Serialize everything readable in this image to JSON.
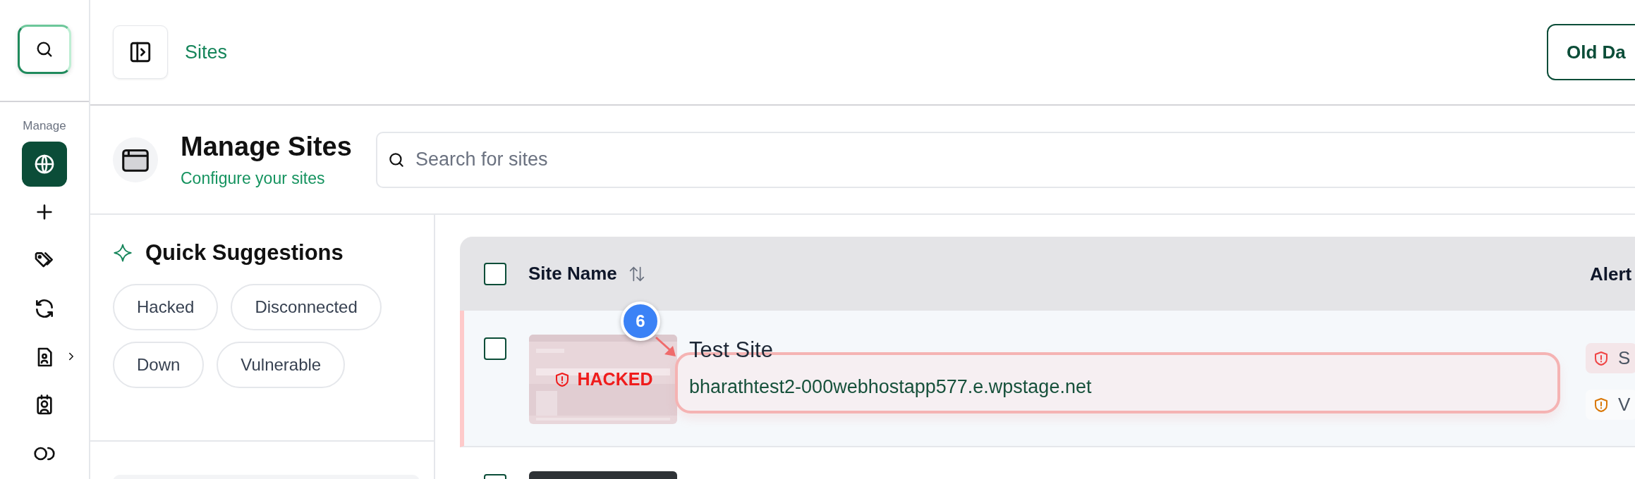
{
  "rail": {
    "section_label": "Manage",
    "items": [
      {
        "kind": "globe",
        "selected": true,
        "has_submenu": false
      },
      {
        "kind": "plus",
        "selected": false,
        "has_submenu": false
      },
      {
        "kind": "tags",
        "selected": false,
        "has_submenu": false
      },
      {
        "kind": "refresh",
        "selected": false,
        "has_submenu": false
      },
      {
        "kind": "report",
        "selected": false,
        "has_submenu": true
      },
      {
        "kind": "contact",
        "selected": false,
        "has_submenu": false
      },
      {
        "kind": "users",
        "selected": false,
        "has_submenu": false
      }
    ]
  },
  "topbar": {
    "breadcrumb": "Sites",
    "button": "Old Da"
  },
  "header": {
    "title": "Manage Sites",
    "subtitle": "Configure your sites",
    "search": {
      "placeholder": "Search for sites"
    }
  },
  "suggestions": {
    "title": "Quick Suggestions",
    "chips": [
      "Hacked",
      "Disconnected",
      "Down",
      "Vulnerable"
    ]
  },
  "table": {
    "columns": [
      "Site Name",
      "Alert"
    ],
    "select_all_checked": false,
    "rows": [
      {
        "checked": false,
        "highlighted": true,
        "status": "HACKED",
        "title": "Test Site",
        "url": "bharathtest2-000webhostapp577.e.wpstage.net",
        "annotation": "6",
        "alerts": [
          {
            "label": "S",
            "color": "#ef4444"
          },
          {
            "label": "V",
            "color": "#d97706"
          }
        ]
      },
      {
        "checked": false,
        "highlighted": false
      }
    ]
  }
}
